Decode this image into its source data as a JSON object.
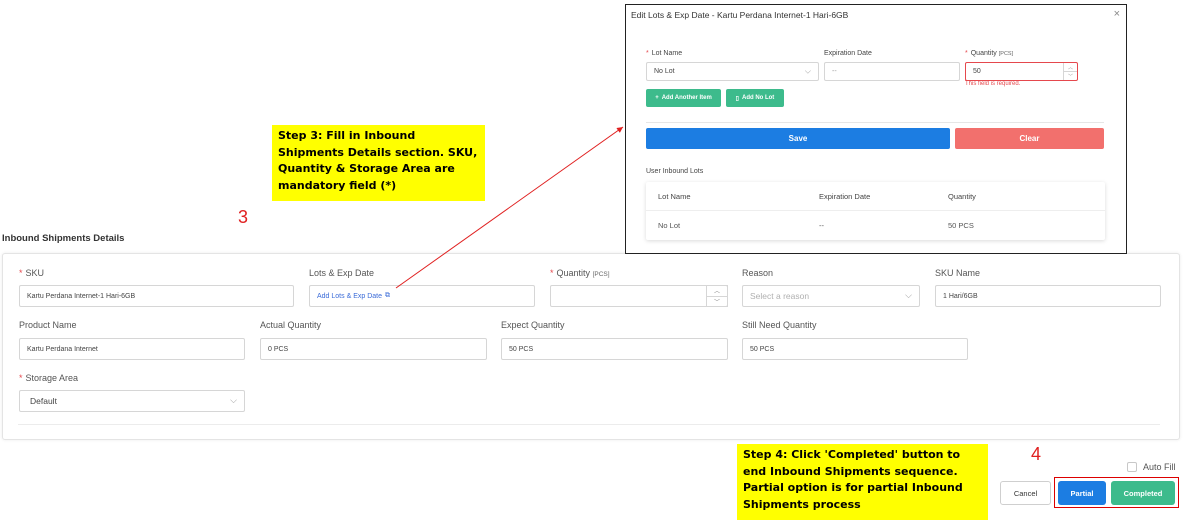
{
  "section_title": "Inbound Shipments Details",
  "fields": {
    "sku": {
      "label": "SKU",
      "value": "Kartu Perdana Internet-1 Hari-6GB"
    },
    "lots": {
      "label": "Lots & Exp Date",
      "link": "Add Lots & Exp Date"
    },
    "quantity": {
      "label": "Quantity",
      "unit": "[PCS]",
      "value": ""
    },
    "reason": {
      "label": "Reason",
      "placeholder": "Select a reason"
    },
    "sku_name": {
      "label": "SKU Name",
      "value": "1 Hari/6GB"
    },
    "product_name": {
      "label": "Product Name",
      "value": "Kartu Perdana Internet"
    },
    "actual_quantity": {
      "label": "Actual Quantity",
      "value": "0 PCS"
    },
    "expect_quantity": {
      "label": "Expect Quantity",
      "value": "50 PCS"
    },
    "still_need_quantity": {
      "label": "Still Need Quantity",
      "value": "50 PCS"
    },
    "storage_area": {
      "label": "Storage Area",
      "value": "Default"
    }
  },
  "required_marker": "*",
  "notes": {
    "step3": "Step 3: Fill in Inbound Shipments Details section. SKU, Quantity & Storage Area are mandatory field (*)",
    "step4": "Step 4: Click 'Completed' button to end Inbound Shipments sequence. Partial option is for partial Inbound Shipments process"
  },
  "step_numbers": {
    "three": "3",
    "four": "4"
  },
  "modal": {
    "title": "Edit Lots & Exp Date - Kartu Perdana Internet-1 Hari-6GB",
    "close": "×",
    "lot_name": {
      "label": "Lot Name",
      "value": "No Lot"
    },
    "expiration_date": {
      "label": "Expiration Date",
      "value": "--"
    },
    "quantity": {
      "label": "Quantity",
      "unit": "[PCS]",
      "value": "50",
      "error": "This field is required."
    },
    "add_another_item": "Add Another Item",
    "add_no_lot": "Add No Lot",
    "save": "Save",
    "clear": "Clear",
    "user_inbound_lots": "User Inbound Lots",
    "table": {
      "headers": [
        "Lot Name",
        "Expiration Date",
        "Quantity"
      ],
      "rows": [
        [
          "No Lot",
          "--",
          "50 PCS"
        ]
      ]
    }
  },
  "actions": {
    "auto_fill": "Auto Fill",
    "cancel": "Cancel",
    "partial": "Partial",
    "completed": "Completed"
  },
  "colors": {
    "primary": "#1c7de2",
    "success": "#3dbb8c",
    "danger": "#f2706d",
    "required": "#e5484d",
    "note_bg": "#ffff00",
    "annotation": "#e02020"
  }
}
